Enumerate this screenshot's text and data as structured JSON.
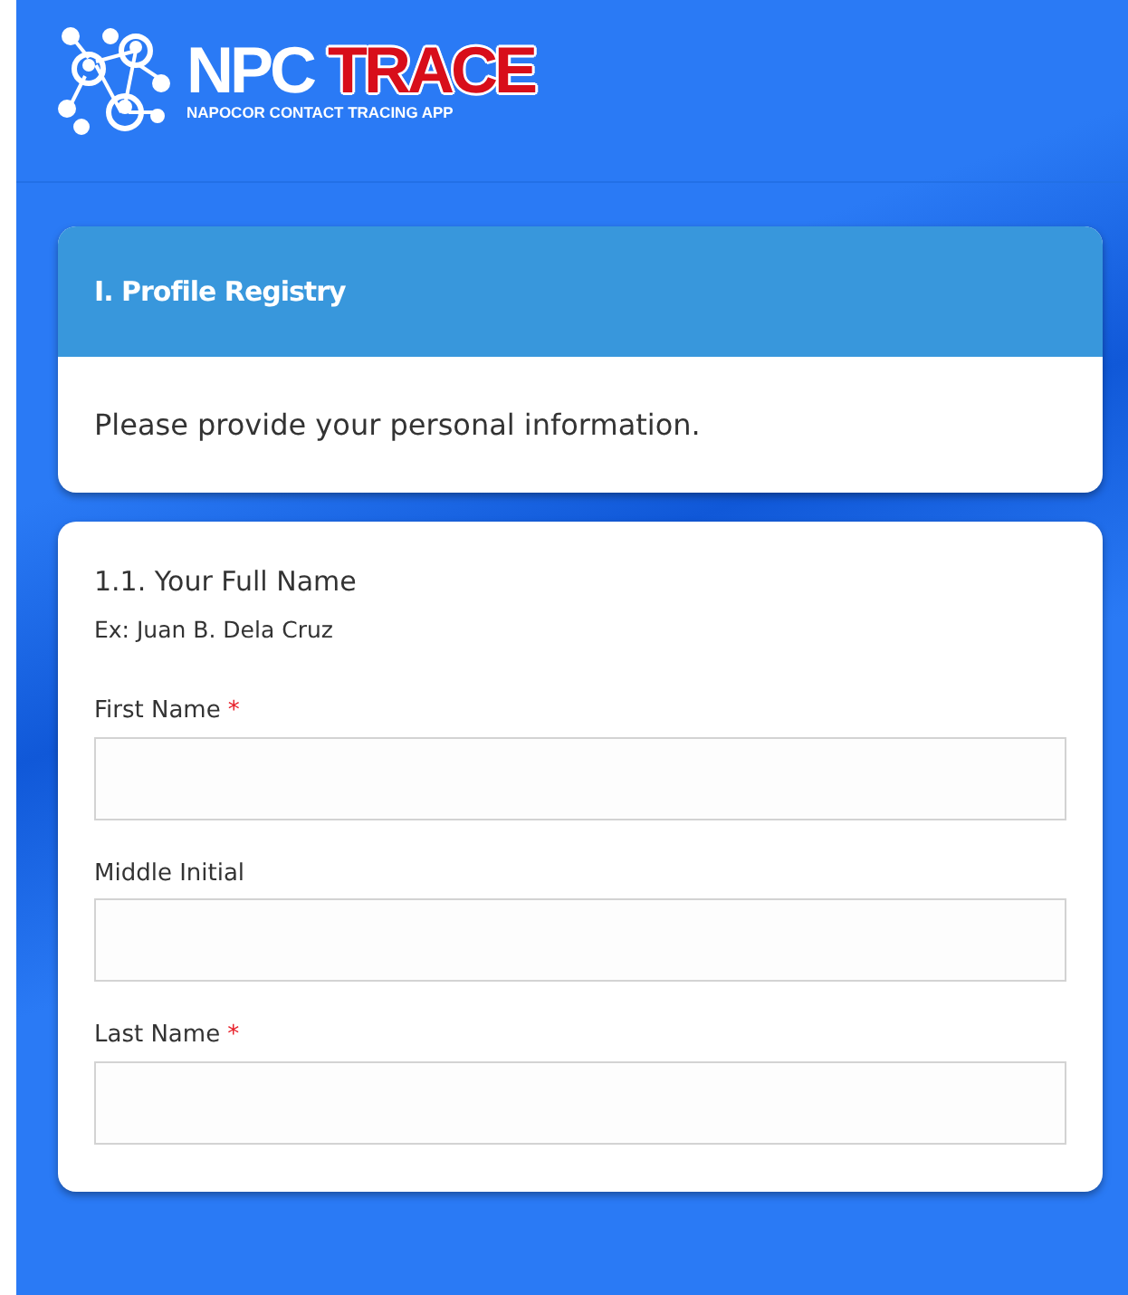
{
  "logo": {
    "title_part_1": "NPC",
    "title_part_2": "TRACE",
    "subtitle": "NAPOCOR CONTACT TRACING APP"
  },
  "section_card": {
    "title": "I. Profile Registry",
    "description": "Please provide your personal information."
  },
  "question": {
    "title": "1.1. Your Full Name",
    "hint": "Ex: Juan B. Dela Cruz",
    "fields": [
      {
        "label": "First Name",
        "required_mark": "*"
      },
      {
        "label": "Middle Initial"
      },
      {
        "label": "Last Name",
        "required_mark": "*"
      }
    ]
  }
}
